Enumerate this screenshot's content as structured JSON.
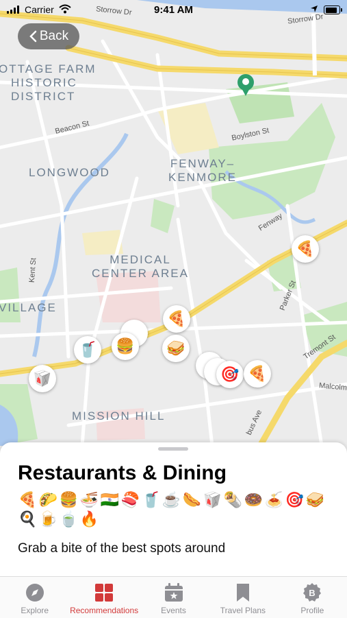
{
  "status_bar": {
    "carrier": "Carrier",
    "time": "9:41 AM"
  },
  "nav": {
    "back_label": "Back"
  },
  "map": {
    "areas": [
      {
        "id": "cottage",
        "text": "OTTAGE FARM HISTORIC DISTRICT",
        "lines": [
          "OTTAGE FARM",
          "HISTORIC",
          "DISTRICT"
        ]
      },
      {
        "id": "longwood",
        "text": "LONGWOOD"
      },
      {
        "id": "fenway",
        "lines": [
          "FENWAY–",
          "KENMORE"
        ]
      },
      {
        "id": "medical",
        "lines": [
          "MEDICAL",
          "CENTER AREA"
        ]
      },
      {
        "id": "village",
        "text": "VILLAGE"
      },
      {
        "id": "mission",
        "text": "MISSION HILL"
      }
    ],
    "streets": {
      "storrow1": "Storrow Dr",
      "storrow2": "Storrow Dr",
      "beacon": "Beacon St",
      "boylston": "Boylston St",
      "fenway": "Fenway",
      "kent": "Kent St",
      "parker": "Parker St",
      "tremont": "Tremont St",
      "malcolm": "Malcolm",
      "bus": "bus Ave"
    },
    "pins": [
      "🍕",
      "🍕",
      "🥤",
      "🍔",
      "🥪",
      "🥡",
      "🎯",
      "🍕"
    ]
  },
  "sheet": {
    "title": "Restaurants & Dining",
    "emojis_row1": [
      "🍕",
      "🌮",
      "🍔",
      "🍜",
      "🇮🇳",
      "🍣",
      "🥤",
      "☕",
      "🌭",
      "🥡",
      "🌯",
      "🍩",
      "🍝",
      "🎯",
      "🥪"
    ],
    "emojis_row2": [
      "🍳",
      "🍺",
      "🍵",
      "🔥"
    ],
    "description": "Grab a bite of the best spots around"
  },
  "tabs": [
    {
      "label": "Explore",
      "icon": "compass-icon",
      "active": false
    },
    {
      "label": "Recommendations",
      "icon": "grid-icon",
      "active": true
    },
    {
      "label": "Events",
      "icon": "calendar-icon",
      "active": false
    },
    {
      "label": "Travel Plans",
      "icon": "bookmark-icon",
      "active": false
    },
    {
      "label": "Profile",
      "icon": "badge-icon",
      "active": false
    }
  ],
  "colors": {
    "accent": "#d23a3a",
    "tab_inactive": "#8e8e93",
    "highway": "#f5d96b",
    "park": "#bfe3b4",
    "water": "#aac8ee"
  }
}
